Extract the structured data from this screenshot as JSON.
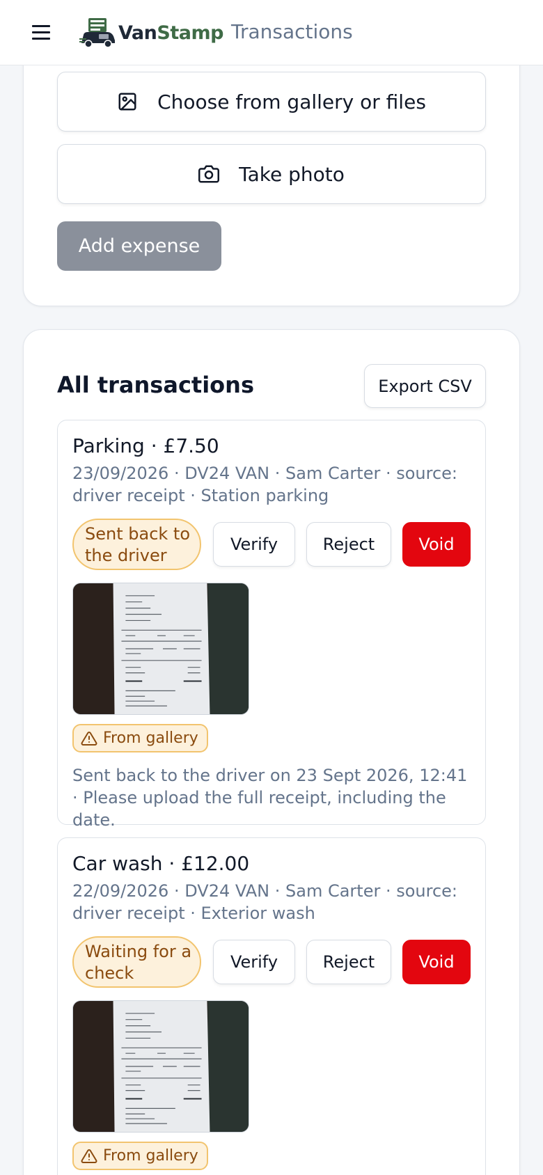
{
  "header": {
    "menu_icon": "hamburger-icon",
    "logo": {
      "part1": "Van",
      "part2": "Stamp",
      "icon": "van-stamp-logo-icon"
    },
    "title": "Transactions"
  },
  "upload": {
    "gallery_label": "Choose from gallery or files",
    "gallery_icon": "image-icon",
    "photo_label": "Take photo",
    "photo_icon": "camera-icon",
    "add_expense_label": "Add expense"
  },
  "transactions": {
    "heading": "All transactions",
    "export_label": "Export CSV",
    "items": [
      {
        "title": "Parking · £7.50",
        "meta": "23/09/2026 · DV24 VAN · Sam Carter · source: driver receipt · Station parking",
        "status": "Sent back to the driver",
        "verify_label": "Verify",
        "reject_label": "Reject",
        "void_label": "Void",
        "source_badge": "From gallery",
        "note": "Sent back to the driver on 23 Sept 2026, 12:41 · Please upload the full receipt, including the date."
      },
      {
        "title": "Car wash · £12.00",
        "meta": "22/09/2026 · DV24 VAN · Sam Carter · source: driver receipt · Exterior wash",
        "status": "Waiting for a check",
        "verify_label": "Verify",
        "reject_label": "Reject",
        "void_label": "Void",
        "source_badge": "From gallery"
      }
    ]
  },
  "colors": {
    "void": "#e3060f",
    "status_bg": "#fdf1dc",
    "status_border": "#f2c46e",
    "status_text": "#8a4b0f",
    "add_expense_bg": "#8a909b",
    "logo_green": "#3f6b46"
  }
}
